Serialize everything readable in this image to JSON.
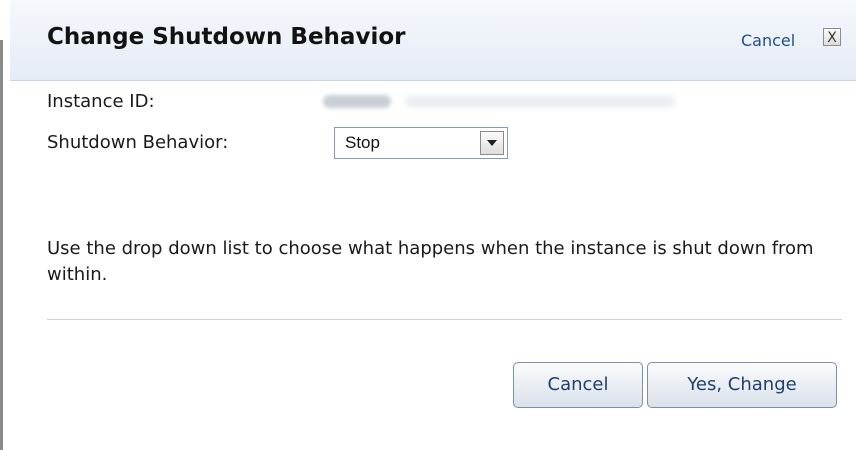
{
  "dialog": {
    "title": "Change Shutdown Behavior",
    "header_cancel": "Cancel",
    "close_glyph": "X"
  },
  "fields": {
    "instance_id_label": "Instance ID:",
    "shutdown_label": "Shutdown Behavior:",
    "shutdown_selected": "Stop"
  },
  "help_text": "Use the drop down list to choose what happens when the instance is shut down from within.",
  "buttons": {
    "cancel": "Cancel",
    "confirm": "Yes, Change"
  },
  "icons": {
    "close": "close-icon",
    "dropdown": "chevron-down-icon"
  }
}
